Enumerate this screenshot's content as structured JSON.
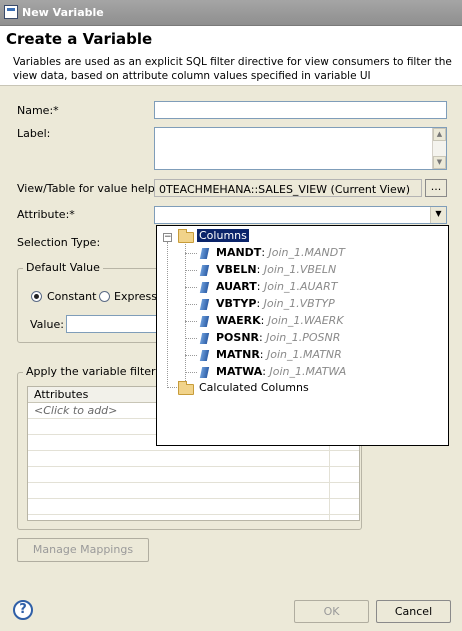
{
  "window": {
    "title": "New Variable"
  },
  "header": {
    "heading": "Create a Variable",
    "description": "Variables are used as an explicit SQL filter directive for view consumers to filter the view data, based on attribute column values specified in variable UI"
  },
  "form": {
    "name_label": "Name:*",
    "name_value": "",
    "label_label": "Label:",
    "label_value": "",
    "view_table_label": "View/Table for value help:*",
    "view_table_value": "0TEACHMEHANA::SALES_VIEW (Current View)",
    "browse_button": "...",
    "attribute_label": "Attribute:*",
    "attribute_value": "",
    "selection_type_label": "Selection Type:"
  },
  "default_value": {
    "group_title": "Default Value",
    "constant_label": "Constant",
    "expression_label": "Express",
    "value_label": "Value:",
    "value_value": ""
  },
  "apply_filter": {
    "group_title": "Apply the variable filter to",
    "table_header": "Attributes",
    "rows": [
      "<Click to add>",
      "",
      "",
      "",
      "",
      "",
      ""
    ]
  },
  "buttons": {
    "manage_mappings": "Manage Mappings",
    "ok": "OK",
    "cancel": "Cancel"
  },
  "attribute_dropdown": {
    "columns_folder": "Columns",
    "columns": [
      {
        "name": "MANDT",
        "source": "Join_1.MANDT"
      },
      {
        "name": "VBELN",
        "source": "Join_1.VBELN"
      },
      {
        "name": "AUART",
        "source": "Join_1.AUART"
      },
      {
        "name": "VBTYP",
        "source": "Join_1.VBTYP"
      },
      {
        "name": "WAERK",
        "source": "Join_1.WAERK"
      },
      {
        "name": "POSNR",
        "source": "Join_1.POSNR"
      },
      {
        "name": "MATNR",
        "source": "Join_1.MATNR"
      },
      {
        "name": "MATWA",
        "source": "Join_1.MATWA"
      }
    ],
    "calculated_folder": "Calculated Columns",
    "collapse_symbol": "−"
  },
  "icons": {
    "help": "?",
    "dropdown": "▼",
    "scroll_up": "▲",
    "scroll_down": "▼"
  },
  "colors": {
    "selection": "#0a246a",
    "titlebar": "#9a9a9a",
    "dialog_bg": "#ece9d8"
  }
}
